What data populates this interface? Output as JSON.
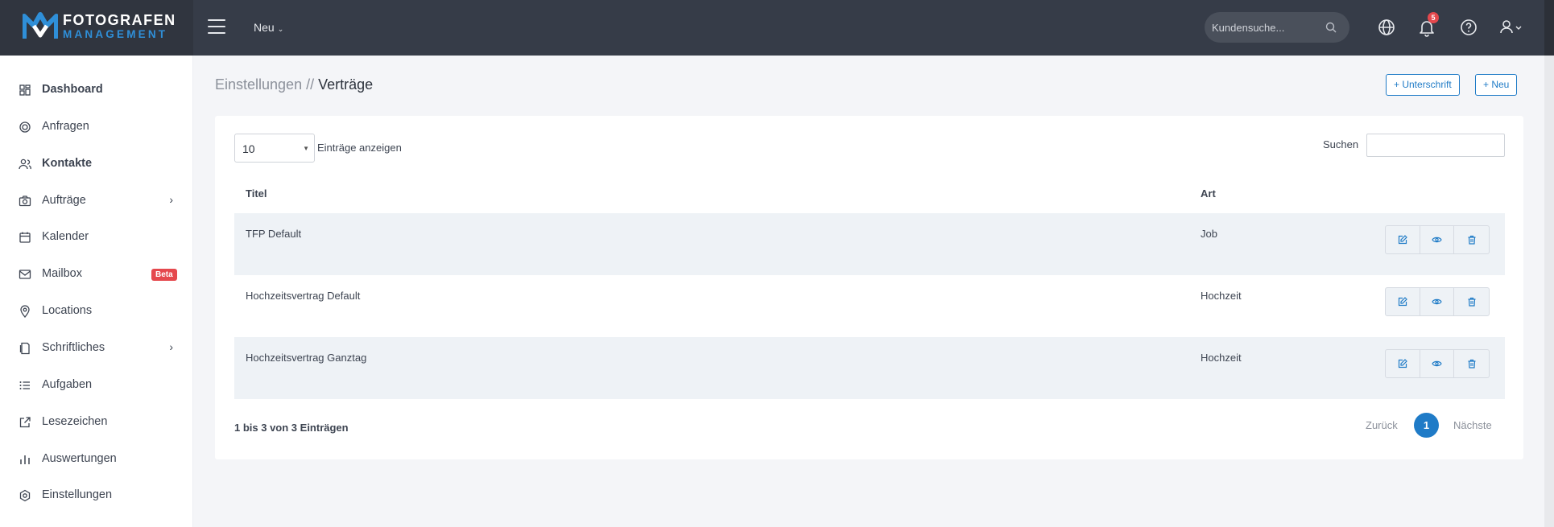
{
  "brand": {
    "line1": "FOTOGRAFEN",
    "line2": "MANAGEMENT"
  },
  "topbar": {
    "new_label": "Neu",
    "search_placeholder": "Kundensuche...",
    "notification_count": "5",
    "icons": [
      "menu-icon",
      "search-icon",
      "globe-icon",
      "bell-icon",
      "help-icon",
      "user-icon"
    ]
  },
  "sidebar": {
    "items": [
      {
        "label": "Dashboard",
        "icon": "dashboard-icon"
      },
      {
        "label": "Anfragen",
        "icon": "target-icon"
      },
      {
        "label": "Kontakte",
        "icon": "users-icon"
      },
      {
        "label": "Aufträge",
        "icon": "camera-icon"
      },
      {
        "label": "Kalender",
        "icon": "calendar-icon"
      },
      {
        "label": "Mailbox",
        "icon": "mail-icon",
        "badge": "Beta"
      },
      {
        "label": "Locations",
        "icon": "map-pin-icon"
      },
      {
        "label": "Schriftliches",
        "icon": "document-icon"
      },
      {
        "label": "Aufgaben",
        "icon": "list-icon"
      },
      {
        "label": "Lesezeichen",
        "icon": "external-link-icon"
      },
      {
        "label": "Auswertungen",
        "icon": "bar-chart-icon"
      },
      {
        "label": "Einstellungen",
        "icon": "settings-icon"
      }
    ]
  },
  "page": {
    "breadcrumb_parent": "Einstellungen",
    "breadcrumb_sep": " // ",
    "breadcrumb_current": "Verträge",
    "btn_signature": "+ Unterschrift",
    "btn_new": "+ Neu"
  },
  "table": {
    "length_value": "10",
    "length_label": "Einträge anzeigen",
    "search_label": "Suchen",
    "columns": [
      "Titel",
      "Art"
    ],
    "rows": [
      {
        "title": "TFP Default",
        "type": "Job"
      },
      {
        "title": "Hochzeitsvertrag Default",
        "type": "Hochzeit"
      },
      {
        "title": "Hochzeitsvertrag Ganztag",
        "type": "Hochzeit"
      }
    ],
    "info": "1 bis 3 von 3 Einträgen",
    "prev": "Zurück",
    "page": "1",
    "next": "Nächste"
  },
  "colors": {
    "accent": "#1f7bc7",
    "topbar": "#363c48",
    "badge": "#e5484d"
  }
}
